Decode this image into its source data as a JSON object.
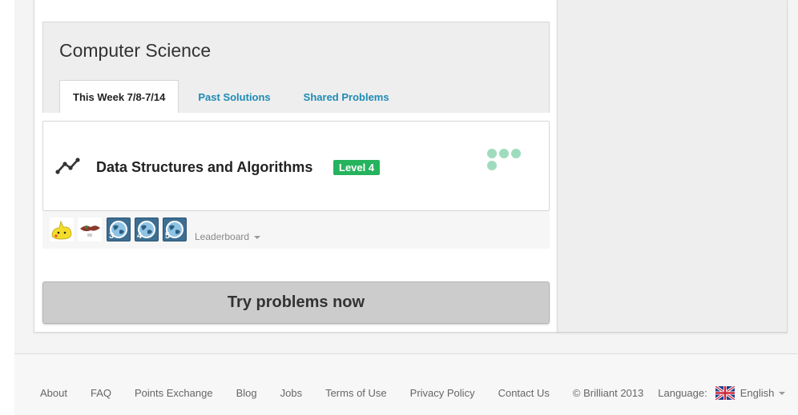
{
  "topic": {
    "title": "Computer Science",
    "tabs": [
      {
        "label": "This Week 7/8-7/14",
        "active": true
      },
      {
        "label": "Past Solutions",
        "active": false
      },
      {
        "label": "Shared Problems",
        "active": false
      }
    ]
  },
  "problem_set": {
    "icon": "line-graph-icon",
    "title": "Data Structures and Algorithms",
    "level": "Level 4",
    "progress_icon": "progress-dots-icon"
  },
  "leaderboard": {
    "avatars": [
      {
        "type": "image",
        "rank": ""
      },
      {
        "type": "image",
        "rank": ""
      },
      {
        "type": "globe",
        "rank": "3"
      },
      {
        "type": "globe",
        "rank": "4"
      },
      {
        "type": "globe",
        "rank": "5"
      }
    ],
    "link_label": "Leaderboard"
  },
  "try_button": {
    "label": "Try problems now"
  },
  "footer": {
    "links": [
      "About",
      "FAQ",
      "Points Exchange",
      "Blog",
      "Jobs",
      "Terms of Use",
      "Privacy Policy",
      "Contact Us"
    ],
    "copyright": "© Brilliant 2013",
    "language_label": "Language:",
    "language_value": "English",
    "flag_icon": "uk-flag-icon"
  },
  "colors": {
    "link": "#1f8bb5",
    "level_badge": "#26b35e",
    "progress_dot": "#9fdcbd",
    "button": "#cccccc"
  }
}
